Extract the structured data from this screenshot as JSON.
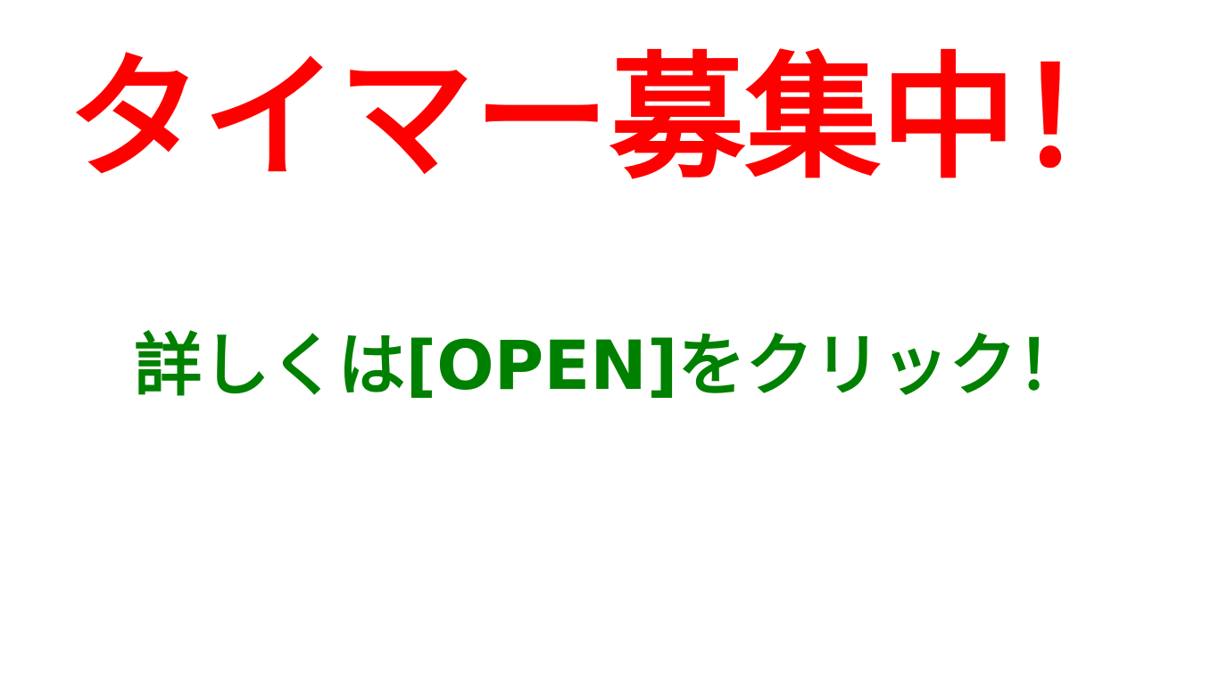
{
  "headline": {
    "text": "タイマー募集中！",
    "color": "#ff0000"
  },
  "subline": {
    "text": "詳しくは[OPEN]をクリック！",
    "color": "#008000"
  },
  "background_color": "#ffffff"
}
